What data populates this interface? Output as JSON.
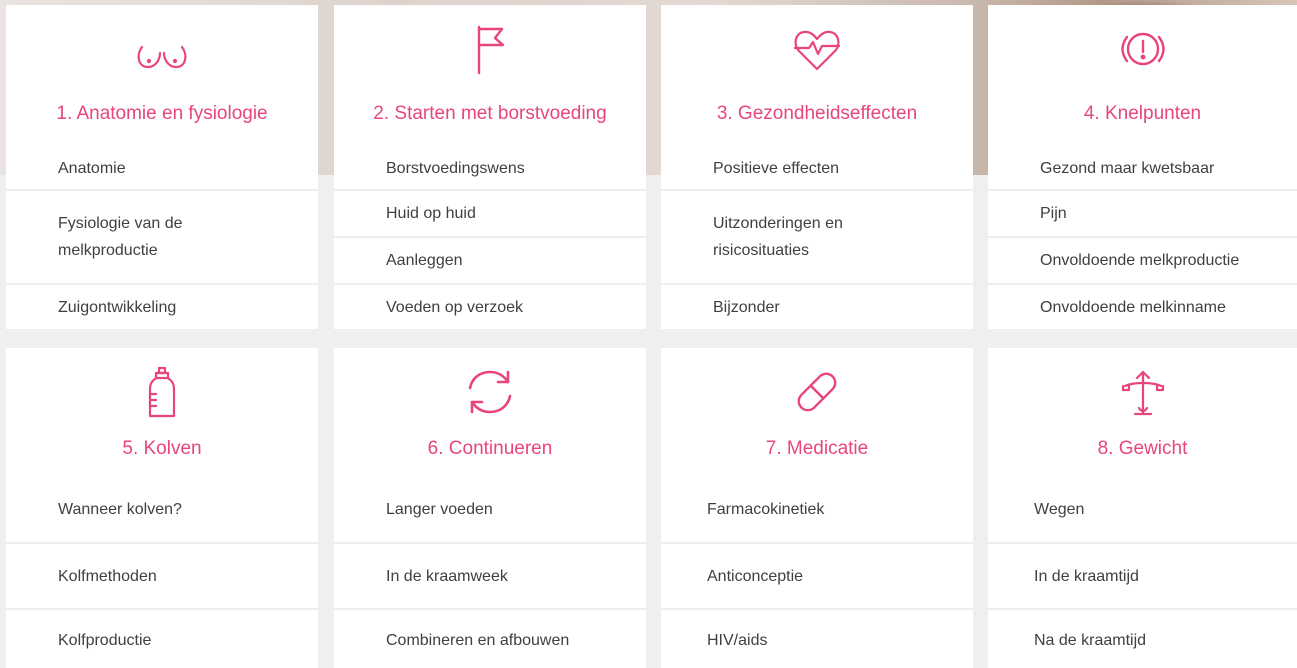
{
  "theme": {
    "accent": "#e8447e",
    "text": "#3f3f3f",
    "divider": "#eeeeee"
  },
  "cards": [
    {
      "icon": "breast-icon",
      "title": "1. Anatomie en fysiologie",
      "items": [
        "Anatomie",
        "Fysiologie van de melkproductie",
        "Zuigontwikkeling"
      ]
    },
    {
      "icon": "flag-icon",
      "title": "2. Starten met borstvoeding",
      "items": [
        "Borstvoedingswens",
        "Huid op huid",
        "Aanleggen",
        "Voeden op verzoek"
      ]
    },
    {
      "icon": "heart-pulse-icon",
      "title": "3. Gezondheidseffecten",
      "items": [
        "Positieve effecten",
        "Uitzonderingen en risicosituaties",
        "Bijzonder"
      ]
    },
    {
      "icon": "alert-circle-icon",
      "title": "4. Knelpunten",
      "items": [
        "Gezond maar kwetsbaar",
        "Pijn",
        "Onvoldoende melkproductie",
        "Onvoldoende melkinname"
      ]
    },
    {
      "icon": "baby-bottle-icon",
      "title": "5. Kolven",
      "items": [
        "Wanneer kolven?",
        "Kolfmethoden",
        "Kolfproductie"
      ]
    },
    {
      "icon": "refresh-icon",
      "title": "6. Continueren",
      "items": [
        "Langer voeden",
        "In de kraamweek",
        "Combineren en afbouwen"
      ]
    },
    {
      "icon": "pill-icon",
      "title": "7. Medicatie",
      "items": [
        "Farmacokinetiek",
        "Anticonceptie",
        "HIV/aids"
      ]
    },
    {
      "icon": "scale-icon",
      "title": "8. Gewicht",
      "items": [
        "Wegen",
        "In de kraamtijd",
        "Na de kraamtijd"
      ]
    }
  ]
}
